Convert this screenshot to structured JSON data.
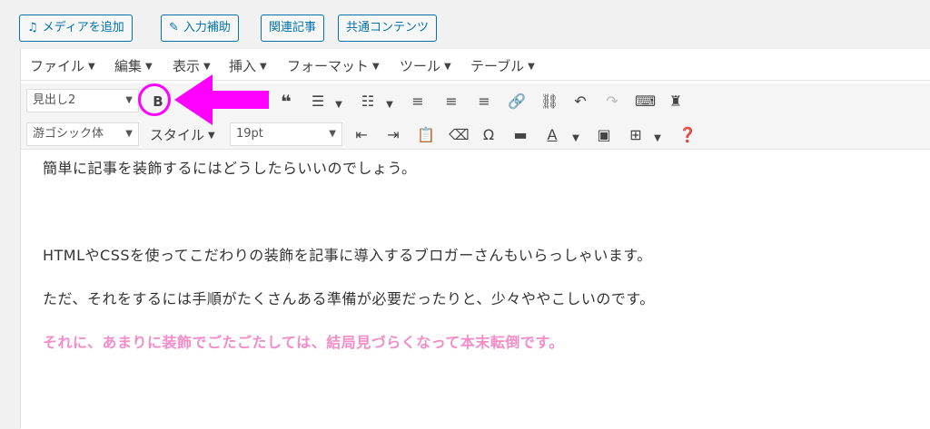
{
  "media_buttons": [
    {
      "icon": "media-icon",
      "label": "メディアを追加"
    },
    {
      "icon": "pencil-icon",
      "label": "入力補助"
    },
    {
      "label": "関連記事"
    },
    {
      "label": "共通コンテンツ"
    }
  ],
  "menubar": [
    "ファイル",
    "編集",
    "表示",
    "挿入",
    "フォーマット",
    "ツール",
    "テーブル"
  ],
  "toolbar1": {
    "format_select": "見出し2"
  },
  "toolbar2": {
    "font_family": "游ゴシック体",
    "style_label": "スタイル",
    "font_size": "19pt"
  },
  "content": {
    "p1": "簡単に記事を装飾するにはどうしたらいいのでしょう。",
    "p2": "HTMLやCSSを使ってこだわりの装飾を記事に導入するブロガーさんもいらっしゃいます。",
    "p3": "ただ、それをするには手順がたくさんある準備が必要だったりと、少々ややこしいのです。",
    "p4": "それに、あまりに装飾でごたごたしては、結局見づらくなって本末転倒です。"
  },
  "colors": {
    "accent": "#0073aa",
    "highlight": "#ff00ff",
    "pink_text": "#f38cc8"
  }
}
